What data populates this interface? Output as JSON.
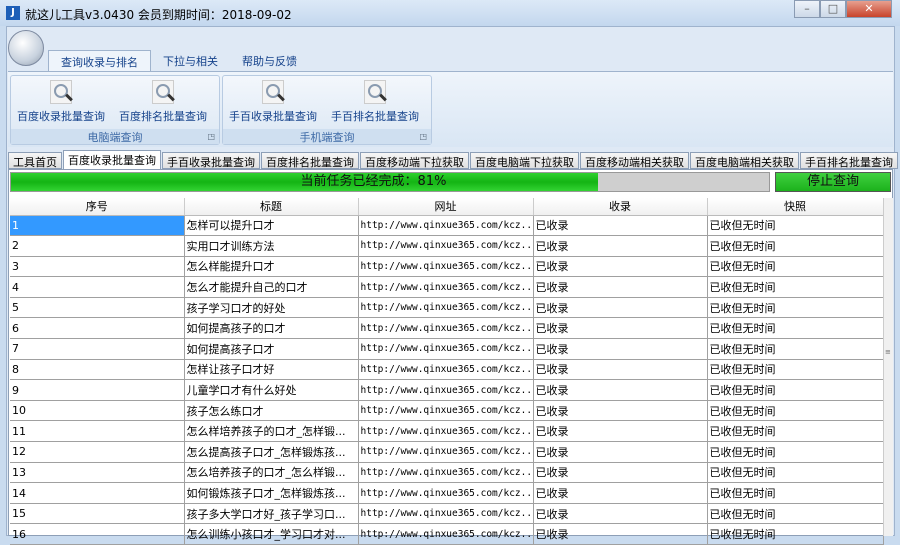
{
  "window": {
    "title": "就这儿工具v3.0430  会员到期时间：2018-09-02",
    "icon_letter": "J",
    "minimize": "–",
    "maximize": "□",
    "close": "✕"
  },
  "ribbon": {
    "tabs": [
      {
        "label": "查询收录与排名",
        "active": true
      },
      {
        "label": "下拉与相关"
      },
      {
        "label": "帮助与反馈"
      }
    ],
    "groups": [
      {
        "label": "电脑端查询",
        "buttons": [
          "百度收录批量查询",
          "百度排名批量查询"
        ]
      },
      {
        "label": "手机端查询",
        "buttons": [
          "手百收录批量查询",
          "手百排名批量查询"
        ]
      }
    ]
  },
  "tabs": [
    "工具首页",
    "百度收录批量查询",
    "手百收录批量查询",
    "百度排名批量查询",
    "百度移动端下拉获取",
    "百度电脑端下拉获取",
    "百度移动端相关获取",
    "百度电脑端相关获取",
    "手百排名批量查询"
  ],
  "active_tab": 1,
  "progress": {
    "text": "当前任务已经完成：81%",
    "percent": 81,
    "color": "#1cc41c"
  },
  "stop_button": "停止查询",
  "table": {
    "columns": [
      "序号",
      "标题",
      "网址",
      "收录",
      "快照"
    ],
    "rows": [
      [
        "1",
        "怎样可以提升口才",
        "http://www.qinxue365.com/kcz...",
        "已收录",
        "已收但无时间"
      ],
      [
        "2",
        "实用口才训练方法",
        "http://www.qinxue365.com/kcz...",
        "已收录",
        "已收但无时间"
      ],
      [
        "3",
        "怎么样能提升口才",
        "http://www.qinxue365.com/kcz...",
        "已收录",
        "已收但无时间"
      ],
      [
        "4",
        "怎么才能提升自己的口才",
        "http://www.qinxue365.com/kcz...",
        "已收录",
        "已收但无时间"
      ],
      [
        "5",
        "孩子学习口才的好处",
        "http://www.qinxue365.com/kcz...",
        "已收录",
        "已收但无时间"
      ],
      [
        "6",
        "如何提高孩子的口才",
        "http://www.qinxue365.com/kcz...",
        "已收录",
        "已收但无时间"
      ],
      [
        "7",
        "如何提高孩子口才",
        "http://www.qinxue365.com/kcz...",
        "已收录",
        "已收但无时间"
      ],
      [
        "8",
        "怎样让孩子口才好",
        "http://www.qinxue365.com/kcz...",
        "已收录",
        "已收但无时间"
      ],
      [
        "9",
        "儿童学口才有什么好处",
        "http://www.qinxue365.com/kcz...",
        "已收录",
        "已收但无时间"
      ],
      [
        "10",
        "孩子怎么练口才",
        "http://www.qinxue365.com/kcz...",
        "已收录",
        "已收但无时间"
      ],
      [
        "11",
        " 怎么样培养孩子的口才_怎样锻...",
        "http://www.qinxue365.com/kcz...",
        "已收录",
        "已收但无时间"
      ],
      [
        "12",
        "怎么提高孩子口才_怎样锻炼孩...",
        "http://www.qinxue365.com/kcz...",
        "已收录",
        "已收但无时间"
      ],
      [
        "13",
        "怎么培养孩子的口才_怎么样锻...",
        "http://www.qinxue365.com/kcz...",
        "已收录",
        "已收但无时间"
      ],
      [
        "14",
        "如何锻炼孩子口才_怎样锻炼孩...",
        "http://www.qinxue365.com/kcz...",
        "已收录",
        "已收但无时间"
      ],
      [
        "15",
        "孩子多大学口才好_孩子学习口...",
        "http://www.qinxue365.com/kcz...",
        "已收录",
        "已收但无时间"
      ],
      [
        "16",
        "怎么训练小孩口才_学习口才对...",
        "http://www.qinxue365.com/kcz...",
        "已收录",
        "已收但无时间"
      ]
    ],
    "selected_row": 0
  }
}
